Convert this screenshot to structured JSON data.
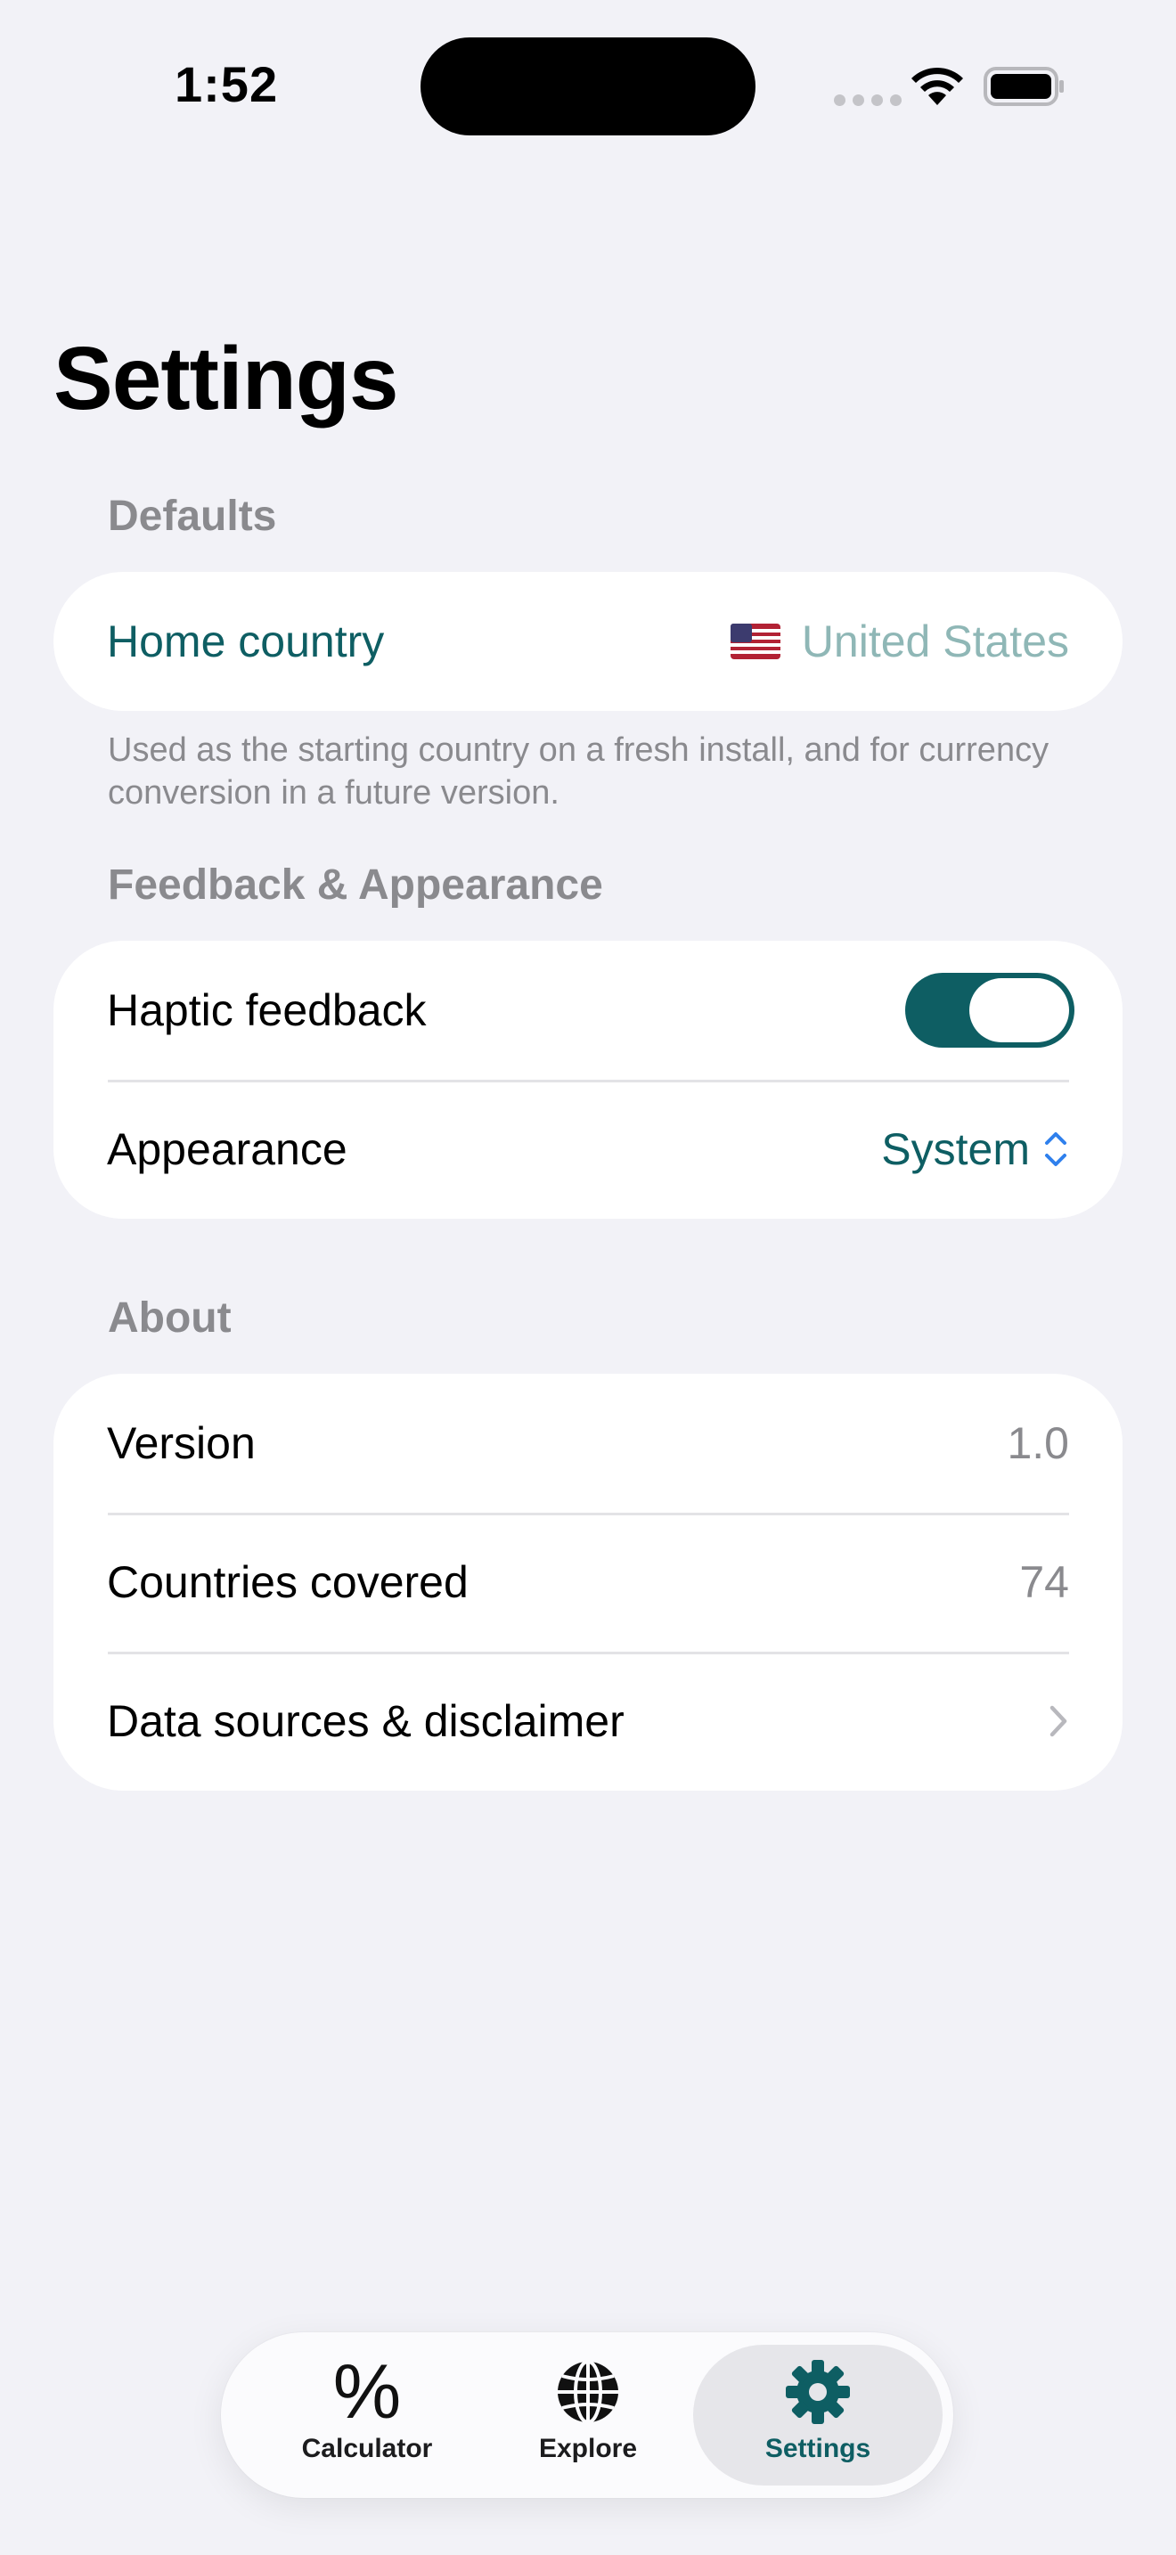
{
  "status_bar": {
    "time": "1:52"
  },
  "page": {
    "title": "Settings"
  },
  "defaults": {
    "header": "Defaults",
    "home_country_label": "Home country",
    "home_country_value": "United States",
    "footnote": "Used as the starting country on a fresh install, and for currency conversion in a future version."
  },
  "feedback": {
    "header": "Feedback & Appearance",
    "haptic_label": "Haptic feedback",
    "haptic_on": true,
    "appearance_label": "Appearance",
    "appearance_value": "System"
  },
  "about": {
    "header": "About",
    "version_label": "Version",
    "version_value": "1.0",
    "countries_label": "Countries covered",
    "countries_value": "74",
    "sources_label": "Data sources & disclaimer"
  },
  "tabs": [
    {
      "label": "Calculator",
      "icon": "percent-icon"
    },
    {
      "label": "Explore",
      "icon": "globe-icon"
    },
    {
      "label": "Settings",
      "icon": "gear-icon"
    }
  ],
  "colors": {
    "accent": "#0E5E63",
    "background": "#F2F2F7",
    "secondary_text": "#8A8A8E"
  }
}
